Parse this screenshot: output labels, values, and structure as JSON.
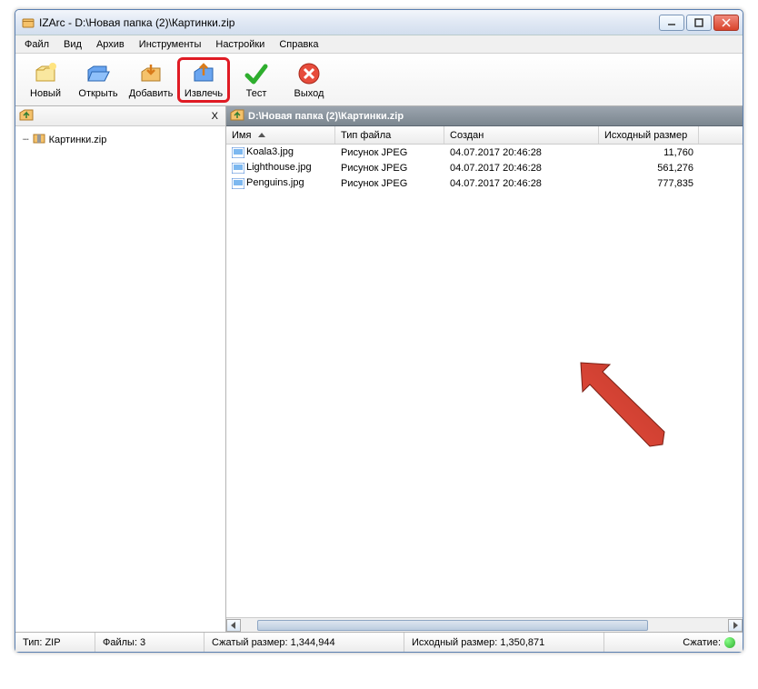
{
  "window": {
    "title": "IZArc - D:\\Новая папка (2)\\Картинки.zip"
  },
  "menu": {
    "items": [
      "Файл",
      "Вид",
      "Архив",
      "Инструменты",
      "Настройки",
      "Справка"
    ]
  },
  "toolbar": {
    "buttons": [
      {
        "label": "Новый",
        "icon": "new"
      },
      {
        "label": "Открыть",
        "icon": "open"
      },
      {
        "label": "Добавить",
        "icon": "add"
      },
      {
        "label": "Извлечь",
        "icon": "extract",
        "highlight": true
      },
      {
        "label": "Тест",
        "icon": "test"
      },
      {
        "label": "Выход",
        "icon": "exit"
      }
    ]
  },
  "sidebar": {
    "tree_item": "Картинки.zip"
  },
  "path": "D:\\Новая папка (2)\\Картинки.zip",
  "columns": {
    "name": "Имя",
    "type": "Тип файла",
    "created": "Создан",
    "size": "Исходный размер"
  },
  "files": [
    {
      "name": "Koala3.jpg",
      "type": "Рисунок JPEG",
      "created": "04.07.2017 20:46:28",
      "size": "11,760"
    },
    {
      "name": "Lighthouse.jpg",
      "type": "Рисунок JPEG",
      "created": "04.07.2017 20:46:28",
      "size": "561,276"
    },
    {
      "name": "Penguins.jpg",
      "type": "Рисунок JPEG",
      "created": "04.07.2017 20:46:28",
      "size": "777,835"
    }
  ],
  "statusbar": {
    "type": "Тип: ZIP",
    "files": "Файлы: 3",
    "compressed": "Сжатый размер: 1,344,944",
    "original": "Исходный размер: 1,350,871",
    "ratio_label": "Сжатие:"
  }
}
